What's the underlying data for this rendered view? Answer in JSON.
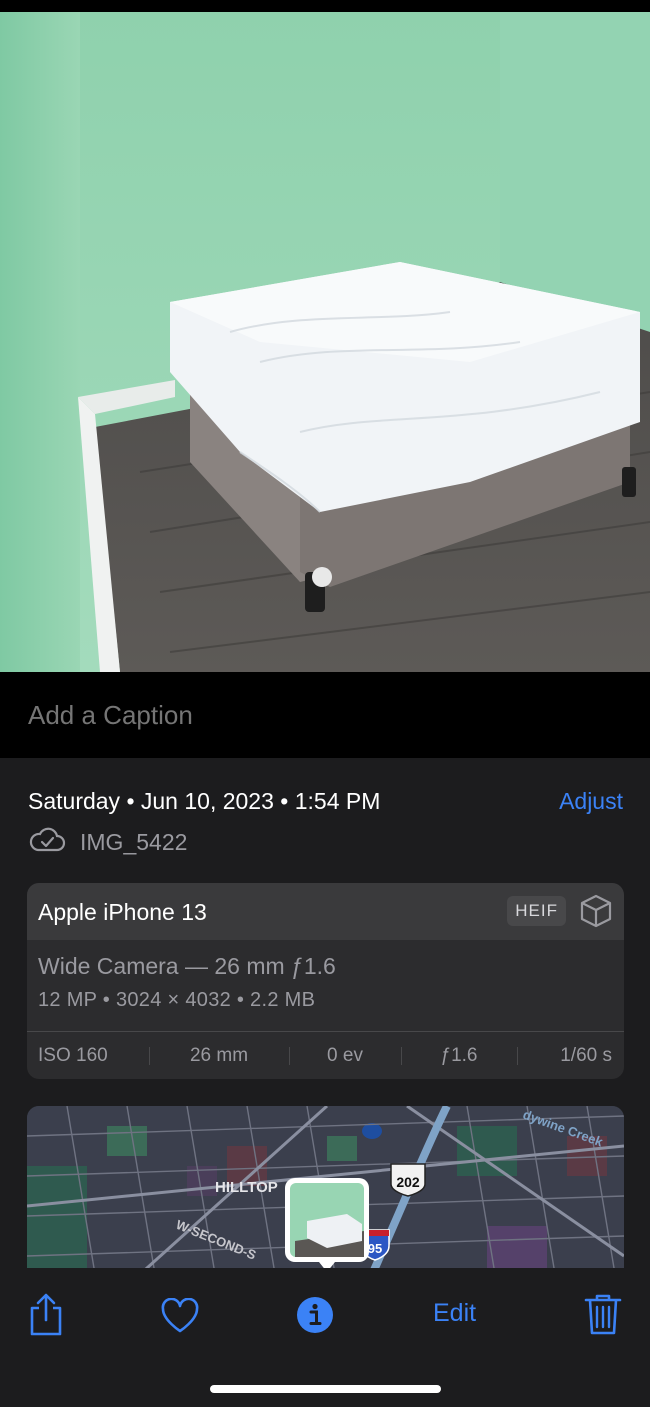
{
  "caption": {
    "placeholder": "Add a Caption"
  },
  "metadata": {
    "date_line": "Saturday • Jun 10, 2023 • 1:54 PM",
    "adjust_label": "Adjust",
    "filename": "IMG_5422"
  },
  "camera_card": {
    "device": "Apple iPhone 13",
    "format_badge": "HEIF",
    "lens": "Wide Camera — 26 mm ƒ1.6",
    "specs": "12 MP  •  3024 × 4032  •  2.2 MB",
    "exif": [
      "ISO 160",
      "26 mm",
      "0 ev",
      "ƒ1.6",
      "1/60 s"
    ]
  },
  "map": {
    "labels": {
      "neighborhood": "HILLTOP",
      "route_202": "202",
      "interstate": "95",
      "street": "W-SECOND-S",
      "creek": "dywine Creek"
    }
  },
  "toolbar": {
    "edit_label": "Edit",
    "icons": [
      "share-icon",
      "heart-icon",
      "info-icon",
      "trash-icon"
    ]
  },
  "colors": {
    "accent": "#3b82f6",
    "panel": "#1c1c1e",
    "card": "#2c2c2e"
  }
}
